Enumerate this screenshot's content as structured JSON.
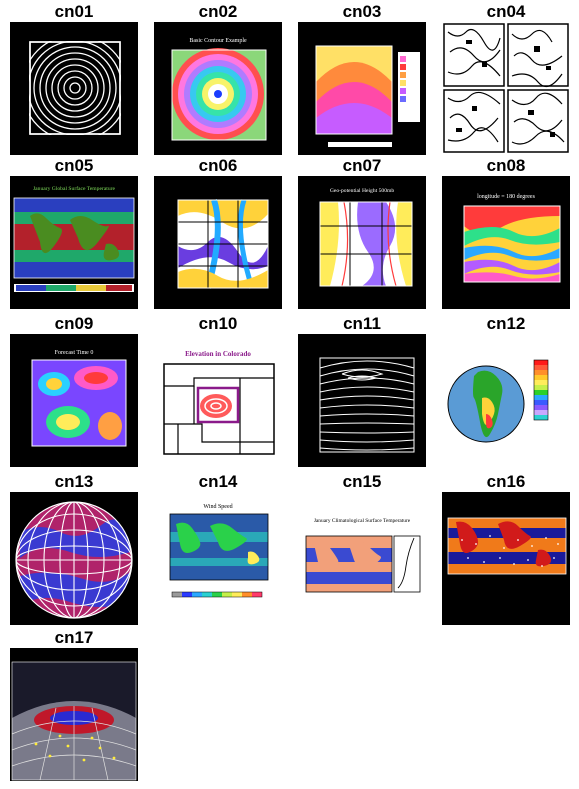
{
  "gallery": {
    "items": [
      {
        "label": "cn01",
        "image_text": ""
      },
      {
        "label": "cn02",
        "image_text": "Basic Contour Example"
      },
      {
        "label": "cn03",
        "image_text": ""
      },
      {
        "label": "cn04",
        "image_text": ""
      },
      {
        "label": "cn05",
        "image_text": "January Global Surface Temperature"
      },
      {
        "label": "cn06",
        "image_text": ""
      },
      {
        "label": "cn07",
        "image_text": "Geo-potential Height 500mb"
      },
      {
        "label": "cn08",
        "image_text": "longitude = 180 degrees"
      },
      {
        "label": "cn09",
        "image_text": "Forecast Time 0"
      },
      {
        "label": "cn10",
        "image_text": "Elevation in Colorado"
      },
      {
        "label": "cn11",
        "image_text": ""
      },
      {
        "label": "cn12",
        "image_text": ""
      },
      {
        "label": "cn13",
        "image_text": ""
      },
      {
        "label": "cn14",
        "image_text": "Wind Speed"
      },
      {
        "label": "cn15",
        "image_text": "January Climatological Surface Temperature"
      },
      {
        "label": "cn16",
        "image_text": ""
      },
      {
        "label": "cn17",
        "image_text": ""
      }
    ]
  },
  "colors": {
    "page_background": "#ffffff",
    "label_color": "#000000",
    "dark_thumb": "#000000"
  }
}
